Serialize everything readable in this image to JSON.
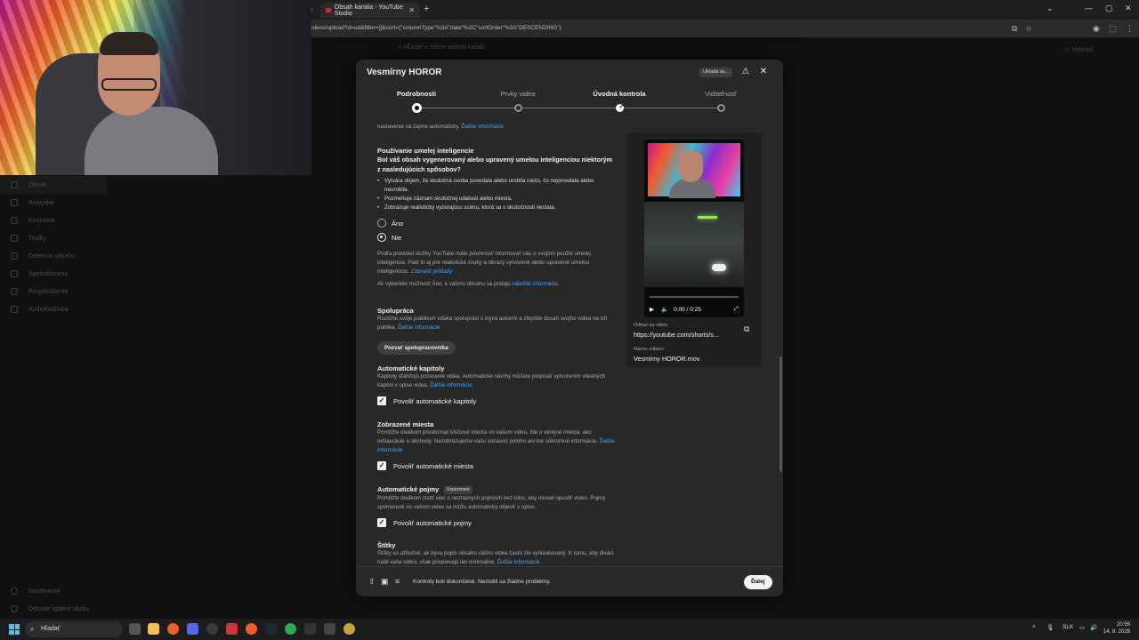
{
  "browser": {
    "tab_title": "Obsah kanála - YouTube Studio",
    "address": "ideos/upload?d=ud&filter=[]&sort={\"columnType\"%3A\"date\"%2C\"sortOrder\"%3A\"DESCENDING\"}"
  },
  "studio_bg": {
    "search_placeholder": "Hľadať v celom vašom kanáli",
    "create_label": "Vytvoriť",
    "sidebar": [
      "Obsah",
      "Analytika",
      "Komunita",
      "Titulky",
      "Detekcia obsahu",
      "Speňažovanie",
      "Prispôsobenie",
      "AudioKnižnica"
    ],
    "sidebar_bottom": [
      "Nastavenia",
      "Odoslať spätnú väzbu"
    ]
  },
  "modal": {
    "title": "Vesmírny HOROR",
    "saving_label": "Ukladá sa...",
    "steps": [
      {
        "label": "Podrobnosti",
        "state": "current"
      },
      {
        "label": "Prvky videa",
        "state": "pending"
      },
      {
        "label": "Úvodná kontrola",
        "state": "done"
      },
      {
        "label": "Viditeľnosť",
        "state": "pending"
      }
    ],
    "top_line": "nastavenie sa zapne automaticky.",
    "top_link": "Ďalšie informácie",
    "ai": {
      "heading": "Používanie umelej inteligencie",
      "question": "Bol váš obsah vygenerovaný alebo upravený umelou inteligenciou niektorým z nasledujúcich spôsobov?",
      "bullets": [
        "Vytvára dojem, že skutočná osoba povedala alebo urobila niečo, čo nepovedala alebo neurobila.",
        "Pozmeňuje záznam skutočnej udalosti alebo miesta.",
        "Zobrazuje realisticky vyzerajúcu scénu, ktorá sa v skutočnosti nestala."
      ],
      "option_yes": "Áno",
      "option_no": "Nie",
      "selected": "Nie",
      "policy_text": "Podľa pravidiel služby YouTube máte povinnosť informovať nás o svojom použití umelej inteligencie. Platí to aj pre realistické zvuky a obrazy vytvorené alebo upravené umelou inteligenciou.",
      "policy_link": "Zobraziť príklady",
      "note_text": "Ak vyberiete možnosť Áno, k vášmu obsahu sa pridajú",
      "note_link": "náležité informácie."
    },
    "collab": {
      "heading": "Spolupráca",
      "text": "Rozšírte svoje publikum vďaka spolupráci s inými autormi a zlepšite dosah svojho videa na ich publiká.",
      "link": "Ďalšie informácie",
      "button": "Pozvať spolupracovníka"
    },
    "chapters": {
      "heading": "Automatické kapitoly",
      "text": "Kapitoly uľahčujú pozeranie videa. Automatické návrhy môžete prepísať vytvorením vlastných kapitol v opise videa.",
      "link": "Ďalšie informácie",
      "checkbox": "Povoliť automatické kapitoly"
    },
    "places": {
      "heading": "Zobrazené miesta",
      "text": "Pomôžte divákom preskúmať kľúčové miesta vo vašom videu. Ide o verejné miesta, ako reštaurácie a obchody. Nezobrazujeme vašu súčasnú polohu ani iné súkromné informácie.",
      "link": "Ďalšie informácie",
      "checkbox": "Povoliť automatické miesta"
    },
    "concepts": {
      "heading": "Automatické pojmy",
      "badge": "Experiment",
      "text": "Pomôžte divákom zistiť viac o neznámych pojmoch bez toho, aby museli opustiť video. Pojmy spomenuté vo vašom videu sa môžu automaticky objaviť v opise.",
      "checkbox": "Povoliť automatické pojmy"
    },
    "tags": {
      "heading": "Štítky",
      "text": "Štítky sú užitočné, ak býva popis obsahu vášho videa často zle vyhláskovaný. K tomu, aby diváci našli vaše video, však prispievajú len minimálne.",
      "link": "Ďalšie informácie"
    },
    "preview": {
      "time": "0:00 / 0:25",
      "link_label": "Odkaz na video",
      "link_value": "https://youtube.com/shorts/s...",
      "file_label": "Názov súboru",
      "file_value": "Vesmírny HOROR.mov"
    },
    "footer": {
      "status": "Kontroly boli dokončené. Nezistili sa žiadne problémy.",
      "next": "Ďalej"
    }
  },
  "taskbar": {
    "search": "Hľadať",
    "lang": "SLK",
    "time": "20:59",
    "date": "14. 8. 2026"
  }
}
